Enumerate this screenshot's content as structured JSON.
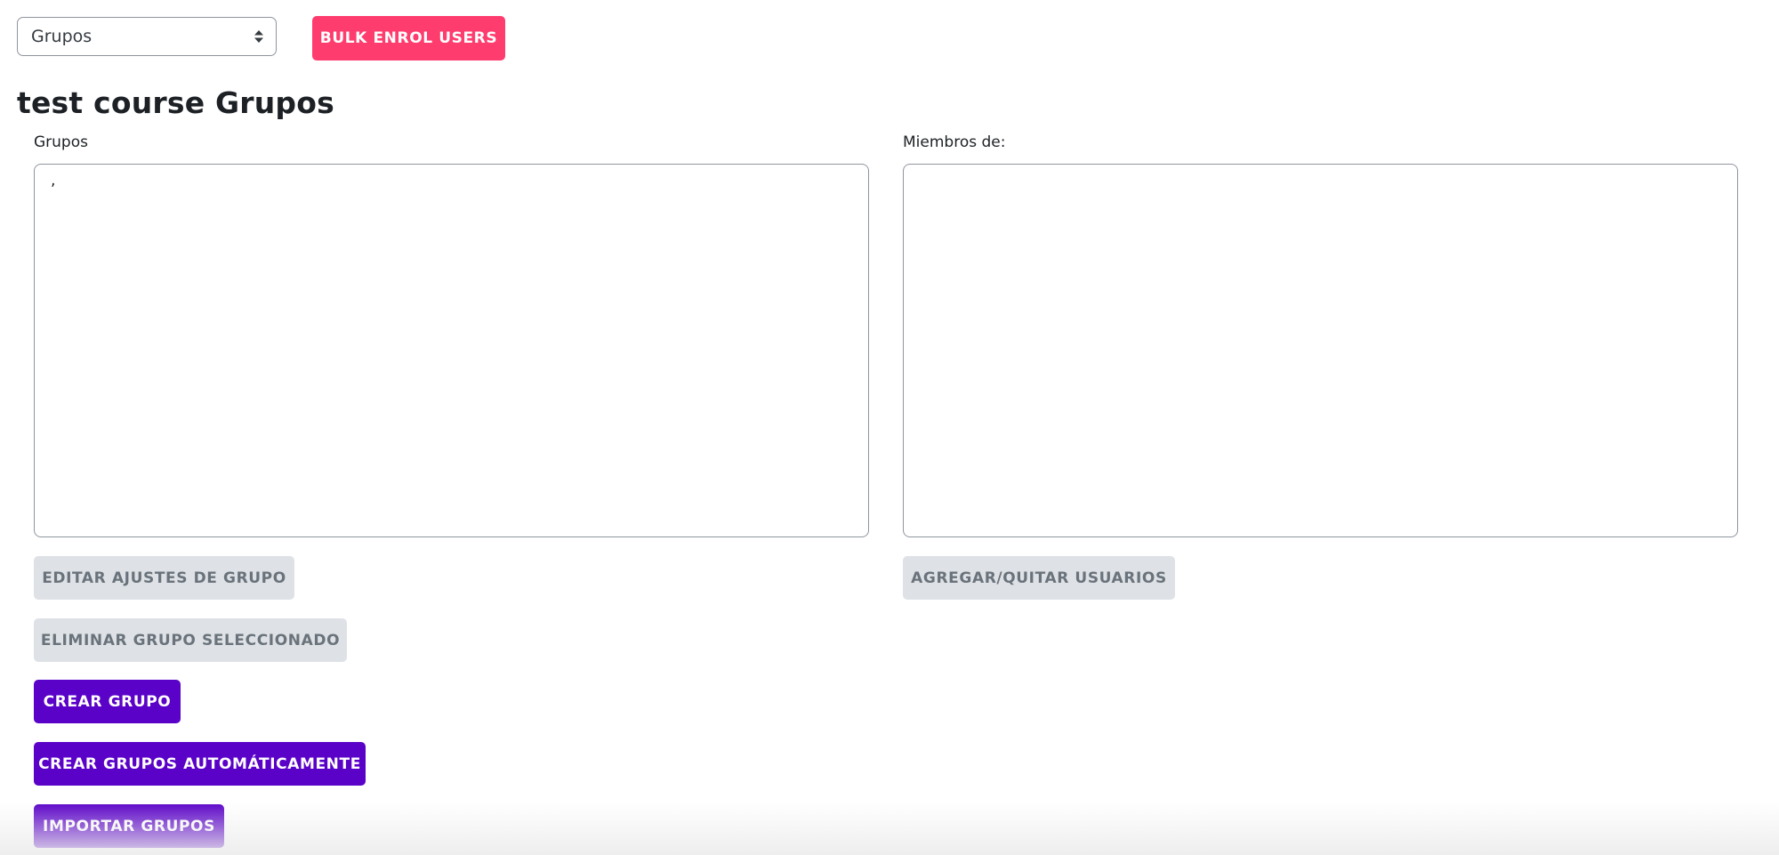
{
  "top_bar": {
    "select": {
      "selected": "Grupos",
      "options": [
        "Grupos"
      ]
    },
    "bulk_enrol_label": "BULK ENROL USERS"
  },
  "page_title": "test course Grupos",
  "groups_panel": {
    "label": "Grupos",
    "items": [
      ","
    ]
  },
  "members_panel": {
    "label": "Miembros de:",
    "items": []
  },
  "buttons": {
    "edit_group": "EDITAR AJUSTES DE GRUPO",
    "delete_group": "ELIMINAR GRUPO SELECCIONADO",
    "create_group": "CREAR GRUPO",
    "auto_create": "CREAR GRUPOS AUTOMÁTICAMENTE",
    "import_groups": "IMPORTAR GRUPOS",
    "add_remove_users": "AGREGAR/QUITAR USUARIOS"
  },
  "colors": {
    "bulk_button": "#ff3c6e",
    "primary_button": "#5a02c8",
    "disabled_button": "#dee2e6"
  },
  "icons": {
    "select_arrows": "sort-arrows-icon"
  }
}
